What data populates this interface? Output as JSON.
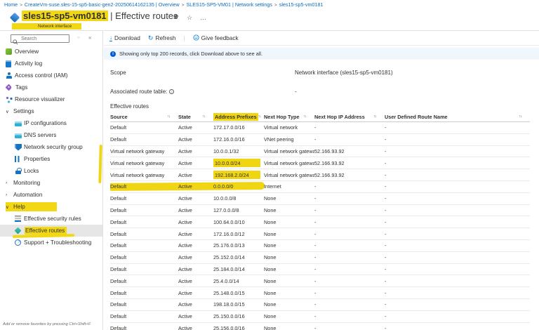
{
  "colors": {
    "accent": "#0078d4",
    "link": "#0a6cbd",
    "highlight": "#f2d714",
    "banner_bg": "#eff6fc"
  },
  "icons": {
    "sort": "↑↓",
    "chevron_expanded": "∨",
    "chevron_collapsed": "›",
    "breadcrumb_separator": ">",
    "star": "☆",
    "ellipsis": "…",
    "collapse": "«",
    "clear": "○",
    "download": "↓",
    "refresh": "↻",
    "info": "i"
  },
  "breadcrumb": {
    "items": [
      "Home",
      "CreateVm-suse.sles-15-sp5-basic-gen2-20250614162135 | Overview",
      "SLES15-SP5-VM01 | Network settings",
      "sles15-sp5-vm0181"
    ]
  },
  "header": {
    "resource_name": "sles15-sp5-vm0181",
    "divider": "|",
    "page_name": "Effective routes",
    "resource_type": "Network interface"
  },
  "sidebar": {
    "search_placeholder": "Search",
    "items": [
      {
        "label": "Overview",
        "icon": "overview"
      },
      {
        "label": "Activity log",
        "icon": "activity-log"
      },
      {
        "label": "Access control (IAM)",
        "icon": "access-control"
      },
      {
        "label": "Tags",
        "icon": "tags"
      },
      {
        "label": "Resource visualizer",
        "icon": "resource-visualizer"
      },
      {
        "label": "Settings",
        "group": true,
        "expanded": true
      },
      {
        "label": "IP configurations",
        "icon": "ip-configurations",
        "indent": true
      },
      {
        "label": "DNS servers",
        "icon": "dns-servers",
        "indent": true
      },
      {
        "label": "Network security group",
        "icon": "network-security-group",
        "indent": true
      },
      {
        "label": "Properties",
        "icon": "properties",
        "indent": true
      },
      {
        "label": "Locks",
        "icon": "locks",
        "indent": true
      },
      {
        "label": "Monitoring",
        "group": true,
        "expanded": false
      },
      {
        "label": "Automation",
        "group": true,
        "expanded": false
      },
      {
        "label": "Help",
        "group": true,
        "expanded": true,
        "highlighted": true
      },
      {
        "label": "Effective security rules",
        "icon": "effective-security-rules",
        "indent": true
      },
      {
        "label": "Effective routes",
        "icon": "effective-routes",
        "indent": true,
        "selected": true,
        "highlighted": true
      },
      {
        "label": "Support + Troubleshooting",
        "icon": "support",
        "indent": true
      }
    ],
    "footer_hint": "Add or remove favorites by pressing Ctrl+Shift+F"
  },
  "toolbar": {
    "download": "Download",
    "refresh": "Refresh",
    "feedback": "Give feedback"
  },
  "banner": {
    "text": "Showing only top 200 records, click Download above to see all."
  },
  "details": {
    "scope_label": "Scope",
    "scope_value": "Network interface (sles15-sp5-vm0181)",
    "route_table_label": "Associated route table:",
    "route_table_value": "-",
    "section_title": "Effective routes"
  },
  "table": {
    "columns": [
      "Source",
      "State",
      "Address Prefixes",
      "Next Hop Type",
      "Next Hop IP Address",
      "User Defined Route Name"
    ],
    "rows": [
      {
        "source": "Default",
        "state": "Active",
        "prefix": "172.17.0.0/16",
        "next_hop_type": "Virtual network",
        "next_hop_ip": "-",
        "udr": "-"
      },
      {
        "source": "Default",
        "state": "Active",
        "prefix": "172.16.0.0/16",
        "next_hop_type": "VNet peering",
        "next_hop_ip": "-",
        "udr": "-"
      },
      {
        "source": "Virtual network gateway",
        "state": "Active",
        "prefix": "10.0.0.1/32",
        "next_hop_type": "Virtual network gateway",
        "next_hop_ip": "52.166.93.92",
        "udr": "-"
      },
      {
        "source": "Virtual network gateway",
        "state": "Active",
        "prefix": "10.0.0.0/24",
        "next_hop_type": "Virtual network gateway",
        "next_hop_ip": "52.166.93.92",
        "udr": "-",
        "highlight_prefix": true
      },
      {
        "source": "Virtual network gateway",
        "state": "Active",
        "prefix": "192.168.2.0/24",
        "next_hop_type": "Virtual network gateway",
        "next_hop_ip": "52.166.93.92",
        "udr": "-",
        "highlight_prefix": true
      },
      {
        "source": "Default",
        "state": "Active",
        "prefix": "0.0.0.0/0",
        "next_hop_type": "Internet",
        "next_hop_ip": "-",
        "udr": "-",
        "highlight_row": true
      },
      {
        "source": "Default",
        "state": "Active",
        "prefix": "10.0.0.0/8",
        "next_hop_type": "None",
        "next_hop_ip": "-",
        "udr": "-"
      },
      {
        "source": "Default",
        "state": "Active",
        "prefix": "127.0.0.0/8",
        "next_hop_type": "None",
        "next_hop_ip": "-",
        "udr": "-"
      },
      {
        "source": "Default",
        "state": "Active",
        "prefix": "100.64.0.0/10",
        "next_hop_type": "None",
        "next_hop_ip": "-",
        "udr": "-"
      },
      {
        "source": "Default",
        "state": "Active",
        "prefix": "172.16.0.0/12",
        "next_hop_type": "None",
        "next_hop_ip": "-",
        "udr": "-"
      },
      {
        "source": "Default",
        "state": "Active",
        "prefix": "25.176.0.0/13",
        "next_hop_type": "None",
        "next_hop_ip": "-",
        "udr": "-"
      },
      {
        "source": "Default",
        "state": "Active",
        "prefix": "25.152.0.0/14",
        "next_hop_type": "None",
        "next_hop_ip": "-",
        "udr": "-"
      },
      {
        "source": "Default",
        "state": "Active",
        "prefix": "25.184.0.0/14",
        "next_hop_type": "None",
        "next_hop_ip": "-",
        "udr": "-"
      },
      {
        "source": "Default",
        "state": "Active",
        "prefix": "25.4.0.0/14",
        "next_hop_type": "None",
        "next_hop_ip": "-",
        "udr": "-"
      },
      {
        "source": "Default",
        "state": "Active",
        "prefix": "25.148.0.0/15",
        "next_hop_type": "None",
        "next_hop_ip": "-",
        "udr": "-"
      },
      {
        "source": "Default",
        "state": "Active",
        "prefix": "198.18.0.0/15",
        "next_hop_type": "None",
        "next_hop_ip": "-",
        "udr": "-"
      },
      {
        "source": "Default",
        "state": "Active",
        "prefix": "25.150.0.0/16",
        "next_hop_type": "None",
        "next_hop_ip": "-",
        "udr": "-"
      },
      {
        "source": "Default",
        "state": "Active",
        "prefix": "25.156.0.0/16",
        "next_hop_type": "None",
        "next_hop_ip": "-",
        "udr": "-"
      }
    ]
  }
}
